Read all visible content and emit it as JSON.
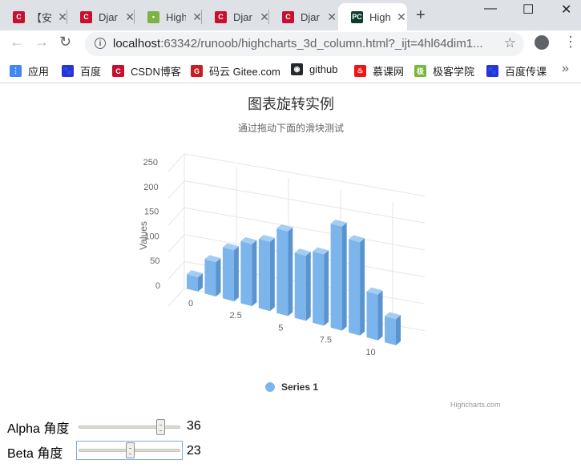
{
  "browser": {
    "tabs": [
      {
        "title": "【安",
        "favicon": "C",
        "color": "#c8102e"
      },
      {
        "title": "Djar",
        "favicon": "C",
        "color": "#c8102e"
      },
      {
        "title": "High",
        "favicon": "•",
        "color": "#7cb342"
      },
      {
        "title": "Djar",
        "favicon": "C",
        "color": "#c8102e"
      },
      {
        "title": "Djar",
        "favicon": "C",
        "color": "#c8102e"
      },
      {
        "title": "High",
        "favicon": "PC",
        "color": "#0b3d2e"
      }
    ],
    "active_tab": 5,
    "new_tab_label": "+",
    "url_host": "localhost",
    "url_rest": ":63342/runoob/highcharts_3d_column.html?_ijt=4hl64dim1...",
    "bookmarks": [
      {
        "label": "应用",
        "icon": "apps-icon",
        "color": "#4285f4"
      },
      {
        "label": "百度",
        "icon": "baidu-paw-icon",
        "color": "#2932e1"
      },
      {
        "label": "CSDN博客",
        "icon": "csdn-icon",
        "color": "#c8102e"
      },
      {
        "label": "码云 Gitee.com",
        "icon": "gitee-icon",
        "color": "#c71d23"
      },
      {
        "label": "github",
        "icon": "github-icon",
        "color": "#24292e"
      },
      {
        "label": "慕课网",
        "icon": "imooc-flame-icon",
        "color": "#f01414"
      },
      {
        "label": "极客学院",
        "icon": "jikexueyuan-icon",
        "color": "#79b83a"
      },
      {
        "label": "百度传课",
        "icon": "baidu-paw-icon",
        "color": "#2932e1"
      }
    ]
  },
  "chart_data": {
    "type": "bar",
    "title": "图表旋转实例",
    "subtitle": "通过拖动下面的滑块测试",
    "ylabel": "Values",
    "xlabel": "",
    "x": [
      0,
      1,
      2,
      3,
      4,
      5,
      6,
      7,
      8,
      9,
      10,
      11
    ],
    "values": [
      29.9,
      71.5,
      106.4,
      129.2,
      144.0,
      176.0,
      135.6,
      148.5,
      216.4,
      194.1,
      95.6,
      54.4
    ],
    "ylim": [
      0,
      250
    ],
    "yticks": [
      0,
      50,
      100,
      150,
      200,
      250
    ],
    "xticks": [
      "0",
      "2.5",
      "5",
      "7.5",
      "10"
    ],
    "xtick_values": [
      0,
      2.5,
      5,
      7.5,
      10
    ],
    "series": [
      {
        "name": "Series 1",
        "color": "#7cb5ec"
      }
    ],
    "legend_position": "bottom",
    "grid": true,
    "credits": "Highcharts.com",
    "options3d": {
      "alpha": 36,
      "beta": 23
    }
  },
  "controls": {
    "alpha_label": "Alpha 角度",
    "alpha_value": "36",
    "alpha_fraction": 0.8,
    "beta_label": "Beta 角度",
    "beta_value": "23",
    "beta_fraction": 0.5
  }
}
